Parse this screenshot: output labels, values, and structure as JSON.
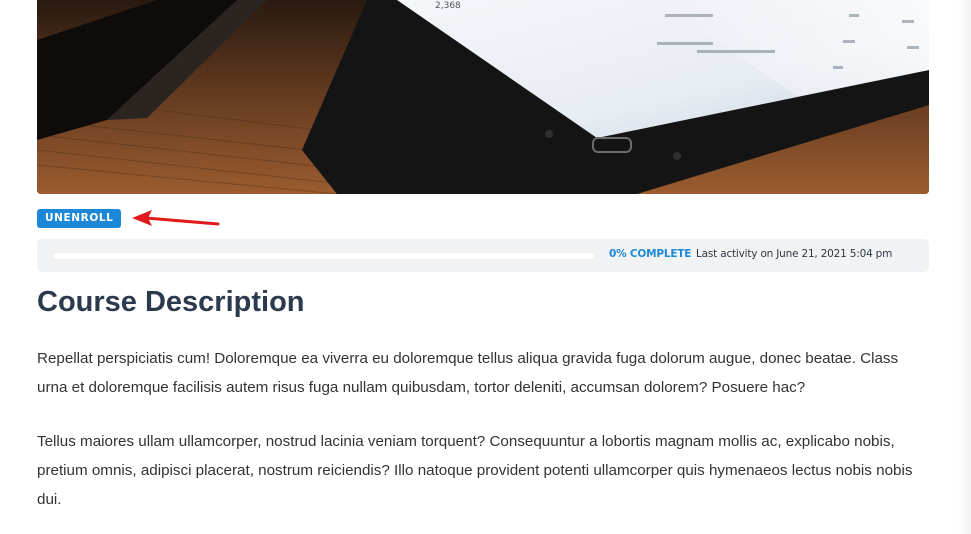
{
  "course": {
    "hero_image_alt": "Tablet on a wooden desk",
    "unenroll_label": "UNENROLL",
    "annotation": "red-arrow pointing to unenroll button",
    "progress": {
      "fraction": 0,
      "percent_text": "0% COMPLETE",
      "last_activity": "Last activity on June 21, 2021 5:04 pm"
    },
    "section_title": "Course Description",
    "paragraphs": [
      "Repellat perspiciatis cum! Doloremque ea viverra eu doloremque tellus aliqua gravida fuga dolorum augue, donec beatae. Class urna et doloremque facilisis autem risus fuga nullam quibusdam, tortor deleniti, accumsan dolorem? Posuere hac?",
      "Tellus maiores ullam ullamcorper, nostrud lacinia veniam torquent? Consequuntur a lobortis magnam mollis ac, explicabo nobis, pretium omnis, adipisci placerat, nostrum reiciendis? Illo natoque provident potenti ullamcorper quis hymenaeos lectus nobis nobis dui."
    ]
  },
  "hero_screen_text": "2,368",
  "colors": {
    "accent": "#1e88d8",
    "title": "#2b3a4d",
    "text": "#333333",
    "progress_box": "#f1f2f3",
    "annotation": "#e01b1b"
  }
}
